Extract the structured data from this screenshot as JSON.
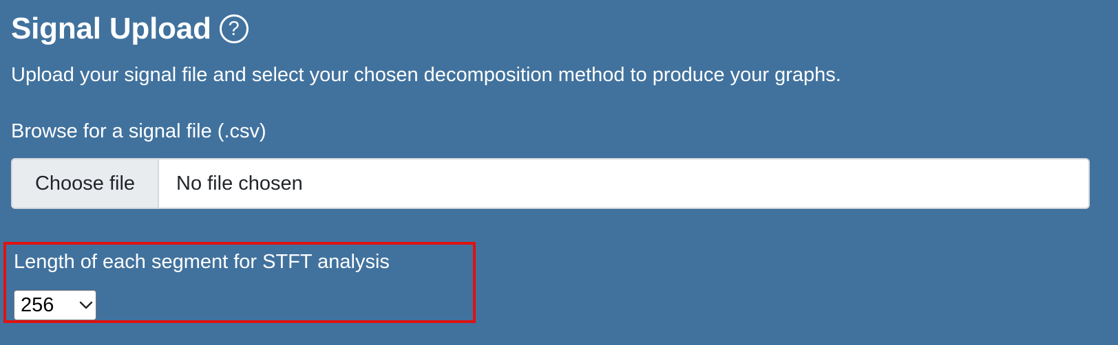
{
  "header": {
    "title": "Signal Upload",
    "help_icon_text": "?"
  },
  "description": "Upload your signal file and select your chosen decomposition method to produce your graphs.",
  "file_upload": {
    "label": "Browse for a signal file (.csv)",
    "button_label": "Choose file",
    "status_text": "No file chosen"
  },
  "segment": {
    "label": "Length of each segment for STFT analysis",
    "selected_value": "256",
    "icon": "chevron-down-icon"
  },
  "colors": {
    "background": "#41729e",
    "highlight_border": "#e01111"
  }
}
